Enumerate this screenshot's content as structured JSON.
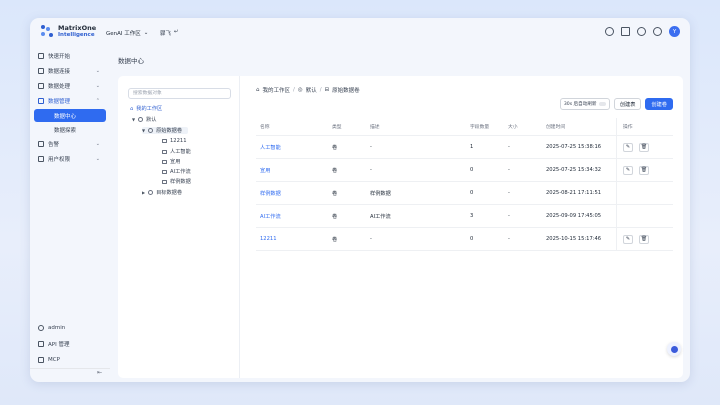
{
  "app": {
    "logo_line1": "MatrixOne",
    "logo_line2": "Intelligence",
    "workspace": "GenAI 工作区",
    "workspace_chevron": "⌄",
    "top_crumb": "骤飞",
    "top_crumb_icon": "↵",
    "avatar": "Y",
    "accent": "#2f6bf0"
  },
  "sidebar": {
    "items": [
      {
        "label": "快速开始",
        "chevron": ""
      },
      {
        "label": "数据连接",
        "chevron": "⌄"
      },
      {
        "label": "数据处理",
        "chevron": "⌄"
      },
      {
        "label": "数据管理",
        "chevron": "⌃"
      },
      {
        "label": "数据中心"
      },
      {
        "label": "数据探索"
      },
      {
        "label": "告警",
        "chevron": "⌄"
      },
      {
        "label": "用户权限",
        "chevron": "⌄"
      }
    ],
    "bottom": [
      {
        "label": "admin"
      },
      {
        "label": "API 管理"
      },
      {
        "label": "MCP"
      }
    ],
    "collapse_icon": "⇤"
  },
  "page": {
    "title": "数据中心"
  },
  "tree": {
    "search_placeholder": "搜索数据对象",
    "root": "我的工作区",
    "default": "默认",
    "raw_db": "原始数据卷",
    "children": [
      "12211",
      "人工智能",
      "宣用",
      "AI工作流",
      "样例数据"
    ],
    "target_db": "目标数据卷"
  },
  "breadcrumb": [
    "我的工作区",
    "默认",
    "原始数据卷"
  ],
  "toolbar": {
    "auto_refresh": "30s 后自动刷新",
    "create_table": "创建表",
    "create_volume": "创建卷"
  },
  "table": {
    "headers": [
      "名称",
      "类型",
      "描述",
      "字段数量",
      "大小",
      "创建时间",
      "操作"
    ],
    "rows": [
      {
        "name": "人工智能",
        "type": "卷",
        "desc": "-",
        "fields": "1",
        "size": "-",
        "time": "2025-07-25 15:38:16",
        "ops": true
      },
      {
        "name": "宣用",
        "type": "卷",
        "desc": "-",
        "fields": "0",
        "size": "-",
        "time": "2025-07-25 15:34:32",
        "ops": true
      },
      {
        "name": "样例数据",
        "type": "卷",
        "desc": "样例数据",
        "fields": "0",
        "size": "-",
        "time": "2025-08-21 17:11:51",
        "ops": false
      },
      {
        "name": "AI工作流",
        "type": "卷",
        "desc": "AI工作流",
        "fields": "3",
        "size": "-",
        "time": "2025-09-09 17:45:05",
        "ops": false
      },
      {
        "name": "12211",
        "type": "卷",
        "desc": "-",
        "fields": "0",
        "size": "-",
        "time": "2025-10-15 15:17:46",
        "ops": true
      }
    ]
  }
}
